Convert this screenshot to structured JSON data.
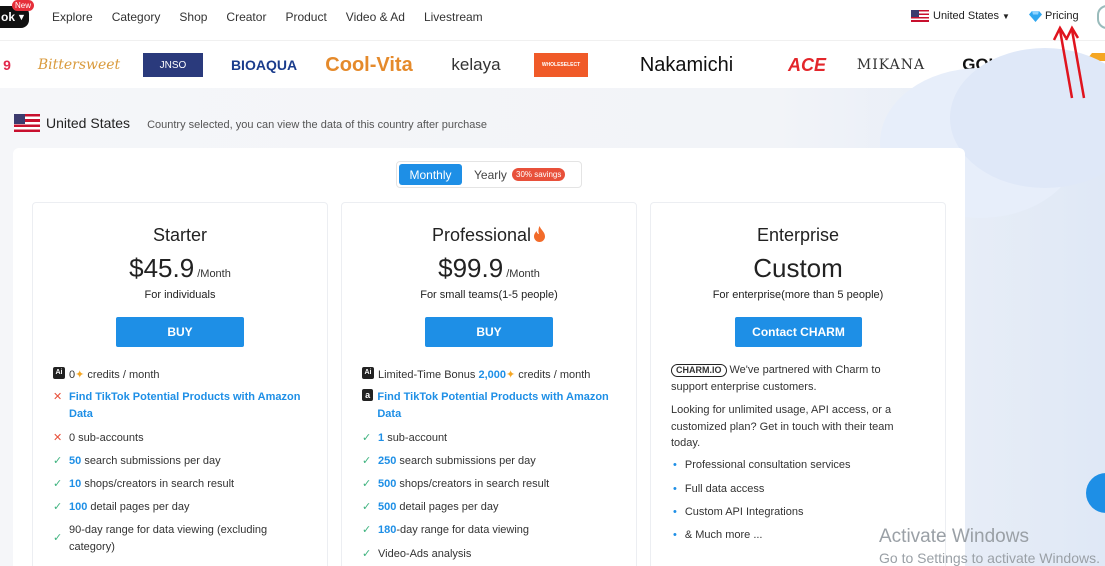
{
  "nav": {
    "brand": "ok",
    "new_badge": "New",
    "links": [
      "Explore",
      "Category",
      "Shop",
      "Creator",
      "Product",
      "Video & Ad",
      "Livestream"
    ],
    "country": "United States",
    "pricing": "Pricing"
  },
  "logos": [
    "9",
    "Bittersweet",
    "JNSO",
    "BIOAQUA",
    "Cool-Vita",
    "kelaya",
    "WHOLESELECT",
    "Nakamichi",
    "ACE",
    "MIKANA",
    "GOUMEE"
  ],
  "country_bar": {
    "name": "United States",
    "note": "Country selected, you can view the data of this country after purchase"
  },
  "toggle": {
    "monthly": "Monthly",
    "yearly": "Yearly",
    "savings": "30% savings"
  },
  "starter": {
    "title": "Starter",
    "price": "$45.9",
    "period": "/Month",
    "subtitle": "For individuals",
    "button": "BUY",
    "f_credits_num": "0",
    "f_credits_text": "credits / month",
    "f_amazon": "Find TikTok Potential Products with Amazon Data",
    "f_subaccounts": "0 sub-accounts",
    "f_search_num": "50",
    "f_search_text": "search submissions per day",
    "f_shops_num": "10",
    "f_shops_text": "shops/creators in search result",
    "f_detail_num": "100",
    "f_detail_text": "detail pages per day",
    "f_range": "90-day range for data viewing (excluding category)"
  },
  "professional": {
    "title": "Professional",
    "price": "$99.9",
    "period": "/Month",
    "subtitle": "For small teams(1-5 people)",
    "button": "BUY",
    "f_bonus_pre": "Limited-Time Bonus",
    "f_bonus_num": "2,000",
    "f_bonus_text": "credits / month",
    "f_amazon": "Find TikTok Potential Products with Amazon Data",
    "f_sub_num": "1",
    "f_sub_text": "sub-account",
    "f_search_num": "250",
    "f_search_text": "search submissions per day",
    "f_shops_num": "500",
    "f_shops_text": "shops/creators in search result",
    "f_detail_num": "500",
    "f_detail_text": "detail pages per day",
    "f_range_num": "180",
    "f_range_text": "-day range for data viewing",
    "f_video": "Video-Ads analysis"
  },
  "enterprise": {
    "title": "Enterprise",
    "price": "Custom",
    "subtitle": "For enterprise(more than 5 people)",
    "button": "Contact CHARM",
    "charm_logo": "CHARM.IO",
    "partner_text": "We've partnered with Charm to support enterprise customers.",
    "looking_text": "Looking for unlimited usage, API access, or a customized plan? Get in touch with their team today.",
    "items": [
      "Professional consultation services",
      "Full data access",
      "Custom API Integrations",
      "& Much more ..."
    ]
  },
  "watermark": {
    "line1": "Activate Windows",
    "line2": "Go to Settings to activate Windows."
  },
  "colors": {
    "accent": "#1e8fe6",
    "savings": "#e8503a",
    "check": "#3fb37f",
    "cross": "#e8503a"
  }
}
